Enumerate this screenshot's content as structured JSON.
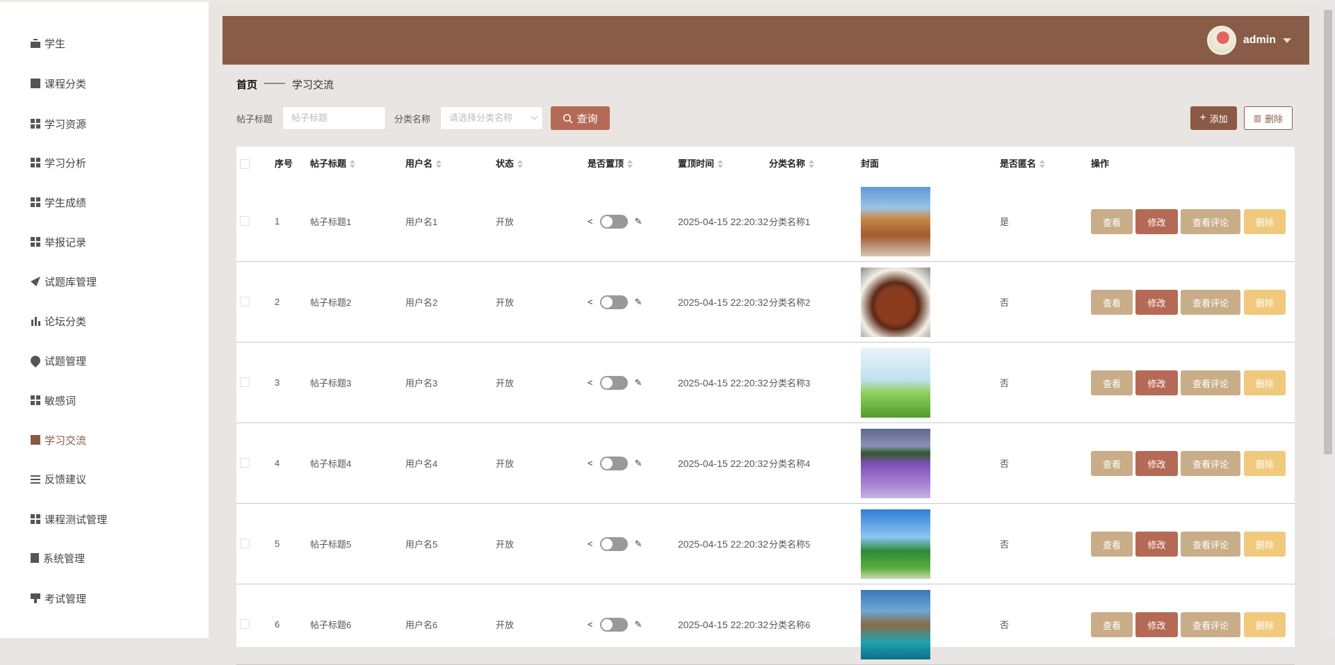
{
  "sidebar": {
    "items": [
      {
        "label": "学生",
        "icon": "briefcase-icon"
      },
      {
        "label": "课程分类",
        "icon": "chart-icon"
      },
      {
        "label": "学习资源",
        "icon": "grid-icon"
      },
      {
        "label": "学习分析",
        "icon": "grid-icon"
      },
      {
        "label": "学生成绩",
        "icon": "grid-icon"
      },
      {
        "label": "举报记录",
        "icon": "grid-icon"
      },
      {
        "label": "试题库管理",
        "icon": "send-icon"
      },
      {
        "label": "论坛分类",
        "icon": "bar-chart-icon"
      },
      {
        "label": "试题管理",
        "icon": "pin-icon"
      },
      {
        "label": "敏感词",
        "icon": "grid-icon"
      },
      {
        "label": "学习交流",
        "icon": "book-icon",
        "active": true
      },
      {
        "label": "反馈建议",
        "icon": "sliders-icon"
      },
      {
        "label": "课程测试管理",
        "icon": "grid-icon"
      },
      {
        "label": "系统管理",
        "icon": "clipboard-icon"
      },
      {
        "label": "考试管理",
        "icon": "monitor-icon"
      }
    ]
  },
  "header": {
    "username": "admin"
  },
  "breadcrumb": {
    "home": "首页",
    "sep": "——",
    "current": "学习交流"
  },
  "search": {
    "title_label": "帖子标题",
    "title_placeholder": "帖子标题",
    "category_label": "分类名称",
    "category_placeholder": "请选择分类名称",
    "query_label": "查询"
  },
  "toolbar": {
    "add_label": "添加",
    "delete_label": "删除"
  },
  "colors": {
    "header": "#895c48",
    "view": "#c9ad88",
    "edit": "#b56a55",
    "comments": "#c9ad88",
    "delete": "#f0c97c",
    "accent": "#8a5a45"
  },
  "table": {
    "columns": [
      "序号",
      "帖子标题",
      "用户名",
      "状态",
      "是否置顶",
      "置顶时间",
      "分类名称",
      "封面",
      "是否匿名",
      "操作"
    ],
    "actions": {
      "view": "查看",
      "edit": "修改",
      "comments": "查看评论",
      "delete": "删除"
    },
    "rows": [
      {
        "no": "1",
        "title": "帖子标题1",
        "user": "用户名1",
        "status": "开放",
        "top_time": "2025-04-15 22:20:32",
        "category": "分类名称1",
        "anonymous": "是"
      },
      {
        "no": "2",
        "title": "帖子标题2",
        "user": "用户名2",
        "status": "开放",
        "top_time": "2025-04-15 22:20:32",
        "category": "分类名称2",
        "anonymous": "否"
      },
      {
        "no": "3",
        "title": "帖子标题3",
        "user": "用户名3",
        "status": "开放",
        "top_time": "2025-04-15 22:20:32",
        "category": "分类名称3",
        "anonymous": "否"
      },
      {
        "no": "4",
        "title": "帖子标题4",
        "user": "用户名4",
        "status": "开放",
        "top_time": "2025-04-15 22:20:32",
        "category": "分类名称4",
        "anonymous": "否"
      },
      {
        "no": "5",
        "title": "帖子标题5",
        "user": "用户名5",
        "status": "开放",
        "top_time": "2025-04-15 22:20:32",
        "category": "分类名称5",
        "anonymous": "否"
      },
      {
        "no": "6",
        "title": "帖子标题6",
        "user": "用户名6",
        "status": "开放",
        "top_time": "2025-04-15 22:20:32",
        "category": "分类名称6",
        "anonymous": "否"
      }
    ]
  }
}
